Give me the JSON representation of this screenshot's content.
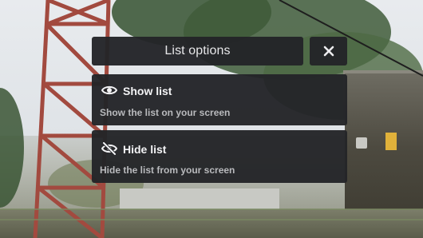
{
  "menu": {
    "title": "List options",
    "close_icon": "close-icon",
    "items": [
      {
        "label": "Show list",
        "description": "Show the list on your screen",
        "icon": "eye-icon"
      },
      {
        "label": "Hide list",
        "description": "Hide the list from your screen",
        "icon": "eye-off-icon"
      }
    ]
  },
  "colors": {
    "panel": "#232428",
    "title_text": "#e7e7e9",
    "item_title_text": "#f3f3f5",
    "item_desc_text": "#b9babd"
  }
}
